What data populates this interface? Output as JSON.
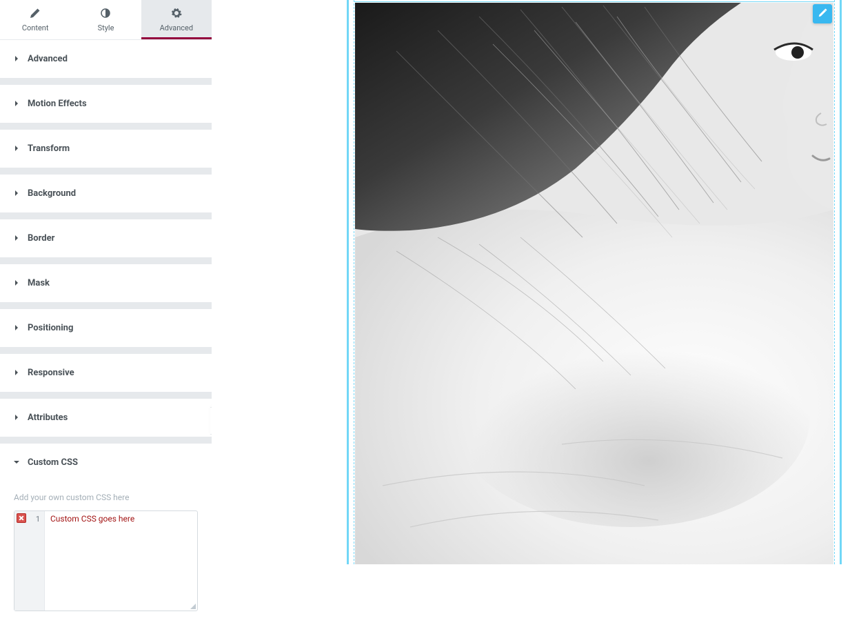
{
  "tabs": {
    "content": "Content",
    "style": "Style",
    "advanced": "Advanced"
  },
  "panels": [
    {
      "label": "Advanced",
      "expanded": false
    },
    {
      "label": "Motion Effects",
      "expanded": false
    },
    {
      "label": "Transform",
      "expanded": false
    },
    {
      "label": "Background",
      "expanded": false
    },
    {
      "label": "Border",
      "expanded": false
    },
    {
      "label": "Mask",
      "expanded": false
    },
    {
      "label": "Positioning",
      "expanded": false
    },
    {
      "label": "Responsive",
      "expanded": false
    },
    {
      "label": "Attributes",
      "expanded": false
    },
    {
      "label": "Custom CSS",
      "expanded": true
    }
  ],
  "customCss": {
    "helper": "Add your own custom CSS here",
    "lineNumber": "1",
    "placeholder": "Custom CSS goes here"
  }
}
